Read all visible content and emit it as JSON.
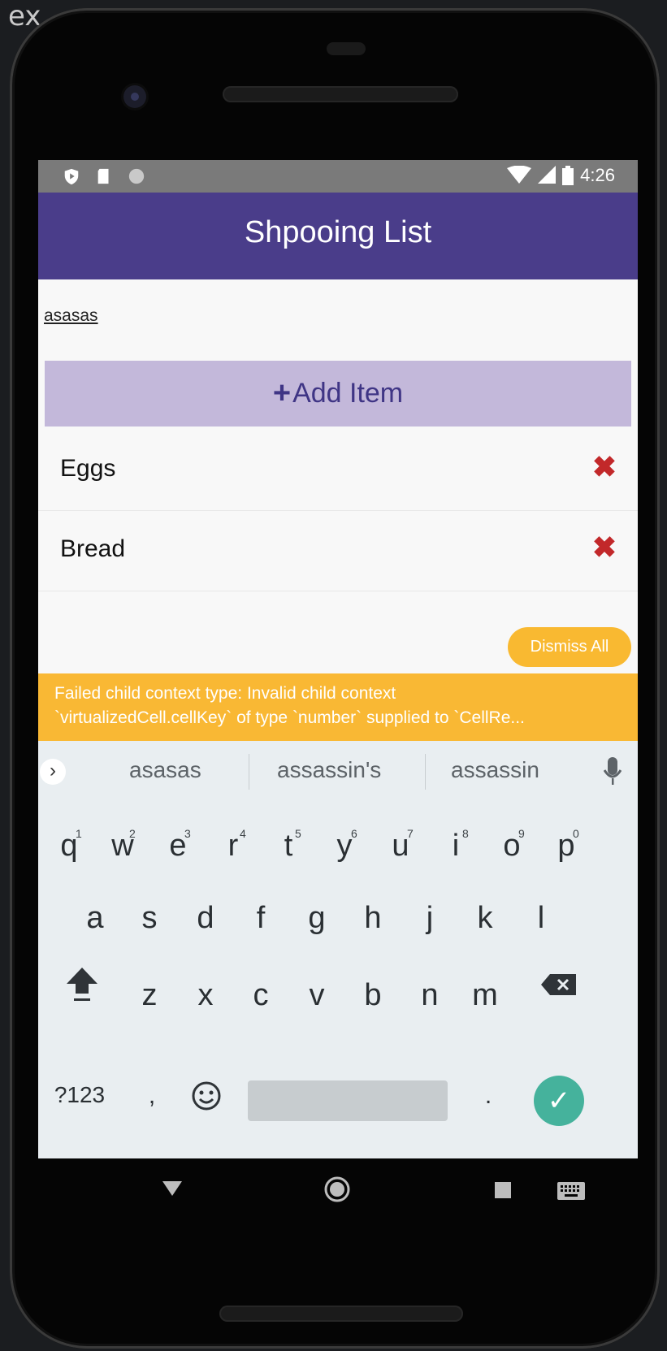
{
  "status_bar": {
    "time": "4:26",
    "left_icons": [
      "play-protect-icon",
      "sd-card-icon",
      "circle-icon"
    ],
    "right_icons": [
      "wifi-icon",
      "signal-icon",
      "battery-icon"
    ]
  },
  "app": {
    "title": "Shpooing List",
    "input_value": "asasas",
    "add_button": {
      "icon": "+",
      "label": "Add Item"
    },
    "items": [
      {
        "label": "Eggs",
        "delete_icon": "✖"
      },
      {
        "label": "Bread",
        "delete_icon": "✖"
      }
    ]
  },
  "warning": {
    "dismiss_label": "Dismiss All",
    "line1": "Failed child context type: Invalid child context",
    "line2": "`virtualizedCell.cellKey` of type `number` supplied to `CellRe..."
  },
  "keyboard": {
    "suggestions": [
      "asasas",
      "assassin's",
      "assassin"
    ],
    "row1": [
      {
        "k": "q",
        "n": "1"
      },
      {
        "k": "w",
        "n": "2"
      },
      {
        "k": "e",
        "n": "3"
      },
      {
        "k": "r",
        "n": "4"
      },
      {
        "k": "t",
        "n": "5"
      },
      {
        "k": "y",
        "n": "6"
      },
      {
        "k": "u",
        "n": "7"
      },
      {
        "k": "i",
        "n": "8"
      },
      {
        "k": "o",
        "n": "9"
      },
      {
        "k": "p",
        "n": "0"
      }
    ],
    "row2": [
      "a",
      "s",
      "d",
      "f",
      "g",
      "h",
      "j",
      "k",
      "l"
    ],
    "row3": [
      "z",
      "x",
      "c",
      "v",
      "b",
      "n",
      "m"
    ],
    "symbols_label": "?123",
    "comma": ",",
    "period": "."
  },
  "colors": {
    "appbar": "#4a3d8a",
    "add_button": "#c3b8da",
    "delete": "#c2282a",
    "warning": "#f9b834",
    "enter": "#45b29c"
  }
}
